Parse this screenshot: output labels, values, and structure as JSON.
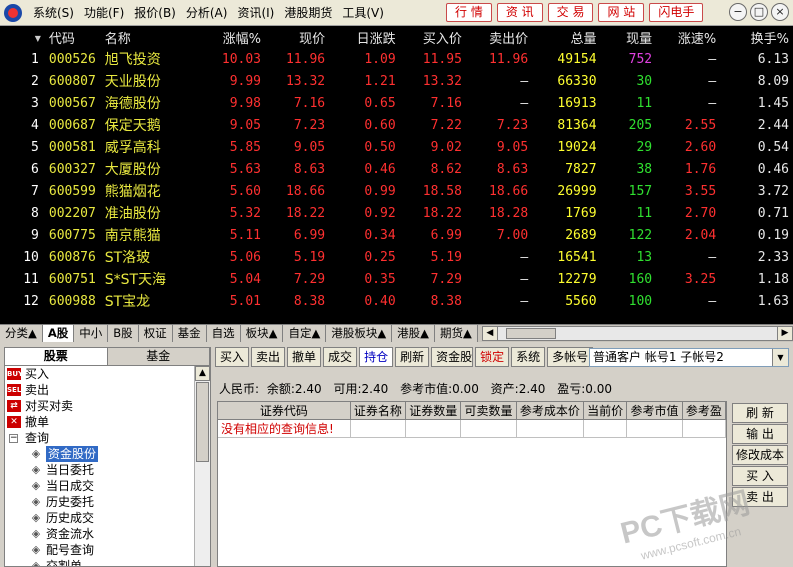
{
  "menu": [
    "系统(S)",
    "功能(F)",
    "报价(B)",
    "分析(A)",
    "资讯(I)",
    "港股期货",
    "工具(V)"
  ],
  "quick_buttons": [
    "行 情",
    "资 讯",
    "交 易",
    "网 站",
    "闪电手"
  ],
  "window_controls": [
    "−",
    "□",
    "×"
  ],
  "quote": {
    "headers": [
      "",
      "代码",
      "名称",
      "涨幅%",
      "现价",
      "日涨跌",
      "买入价",
      "卖出价",
      "总量",
      "现量",
      "涨速%",
      "换手%"
    ],
    "rows": [
      {
        "idx": "1",
        "code": "000526",
        "name": "旭飞投资",
        "chg_pct": "10.03",
        "price": "11.96",
        "chg": "1.09",
        "bid": "11.95",
        "ask": "11.96",
        "vol": "49154",
        "cur": "752",
        "speed": "—",
        "turn": "6.13"
      },
      {
        "idx": "2",
        "code": "600807",
        "name": "天业股份",
        "chg_pct": "9.99",
        "price": "13.32",
        "chg": "1.21",
        "bid": "13.32",
        "ask": "—",
        "vol": "66330",
        "cur": "30",
        "speed": "—",
        "turn": "8.09"
      },
      {
        "idx": "3",
        "code": "000567",
        "name": "海德股份",
        "chg_pct": "9.98",
        "price": "7.16",
        "chg": "0.65",
        "bid": "7.16",
        "ask": "—",
        "vol": "16913",
        "cur": "11",
        "speed": "—",
        "turn": "1.45"
      },
      {
        "idx": "4",
        "code": "000687",
        "name": "保定天鹅",
        "chg_pct": "9.05",
        "price": "7.23",
        "chg": "0.60",
        "bid": "7.22",
        "ask": "7.23",
        "vol": "81364",
        "cur": "205",
        "speed": "2.55",
        "turn": "2.44"
      },
      {
        "idx": "5",
        "code": "000581",
        "name": "威孚高科",
        "chg_pct": "5.85",
        "price": "9.05",
        "chg": "0.50",
        "bid": "9.02",
        "ask": "9.05",
        "vol": "19024",
        "cur": "29",
        "speed": "2.60",
        "turn": "0.54"
      },
      {
        "idx": "6",
        "code": "600327",
        "name": "大厦股份",
        "chg_pct": "5.63",
        "price": "8.63",
        "chg": "0.46",
        "bid": "8.62",
        "ask": "8.63",
        "vol": "7827",
        "cur": "38",
        "speed": "1.76",
        "turn": "0.46"
      },
      {
        "idx": "7",
        "code": "600599",
        "name": "熊猫烟花",
        "chg_pct": "5.60",
        "price": "18.66",
        "chg": "0.99",
        "bid": "18.58",
        "ask": "18.66",
        "vol": "26999",
        "cur": "157",
        "speed": "3.55",
        "turn": "3.72"
      },
      {
        "idx": "8",
        "code": "002207",
        "name": "准油股份",
        "chg_pct": "5.32",
        "price": "18.22",
        "chg": "0.92",
        "bid": "18.22",
        "ask": "18.28",
        "vol": "1769",
        "cur": "11",
        "speed": "2.70",
        "turn": "0.71"
      },
      {
        "idx": "9",
        "code": "600775",
        "name": "南京熊猫",
        "chg_pct": "5.11",
        "price": "6.99",
        "chg": "0.34",
        "bid": "6.99",
        "ask": "7.00",
        "vol": "2689",
        "cur": "122",
        "speed": "2.04",
        "turn": "0.19"
      },
      {
        "idx": "10",
        "code": "600876",
        "name": "ST洛玻",
        "chg_pct": "5.06",
        "price": "5.19",
        "chg": "0.25",
        "bid": "5.19",
        "ask": "—",
        "vol": "16541",
        "cur": "13",
        "speed": "—",
        "turn": "2.33"
      },
      {
        "idx": "11",
        "code": "600751",
        "name": "S*ST天海",
        "chg_pct": "5.04",
        "price": "7.29",
        "chg": "0.35",
        "bid": "7.29",
        "ask": "—",
        "vol": "12279",
        "cur": "160",
        "speed": "3.25",
        "turn": "1.18"
      },
      {
        "idx": "12",
        "code": "600988",
        "name": "ST宝龙",
        "chg_pct": "5.01",
        "price": "8.38",
        "chg": "0.40",
        "bid": "8.38",
        "ask": "—",
        "vol": "5560",
        "cur": "100",
        "speed": "—",
        "turn": "1.63"
      }
    ]
  },
  "tabs": [
    "分类▲",
    "A股",
    "中小",
    "B股",
    "权证",
    "基金",
    "自选",
    "板块▲",
    "自定▲",
    "港股板块▲",
    "港股▲",
    "期货▲"
  ],
  "left_tabs": [
    "股票",
    "基金"
  ],
  "tree": {
    "top": [
      {
        "label": "买入",
        "icon": "BUY"
      },
      {
        "label": "卖出",
        "icon": "SELL"
      },
      {
        "label": "对买对卖",
        "icon": "⇄"
      },
      {
        "label": "撤单",
        "icon": "✕"
      }
    ],
    "query_label": "查询",
    "query_box": "−",
    "leaves": [
      "资金股份",
      "当日委托",
      "当日成交",
      "历史委托",
      "历史成交",
      "资金流水",
      "配号查询",
      "交割单"
    ]
  },
  "toolbar": [
    "买入",
    "卖出",
    "撤单",
    "成交",
    "持仓",
    "刷新",
    "资金股份",
    "锁定",
    "系统",
    "多帐号"
  ],
  "account_select": "普通客户 帐号1  子帐号2",
  "summary": {
    "currency": "人民币:",
    "balance": "余额:2.40",
    "available": "可用:2.40",
    "ref_market": "参考市值:0.00",
    "assets": "资产:2.40",
    "pnl": "盈亏:0.00"
  },
  "grid": {
    "headers": [
      "证券代码",
      "证券名称",
      "证券数量",
      "可卖数量",
      "参考成本价",
      "当前价",
      "参考市值",
      "参考盈"
    ],
    "message": "没有相应的查询信息!"
  },
  "side_buttons": [
    "刷 新",
    "输 出",
    "修改成本",
    "买 入",
    "卖 出"
  ],
  "watermark": {
    "title": "PC下载网",
    "url": "www.pcsoft.com.cn"
  },
  "colors": {
    "up": "#ff3030",
    "code": "#e8e840",
    "volume": "#ffff30",
    "down_vol": "#30e030",
    "accent_cur": "#e040e0",
    "selection": "#316ac5"
  }
}
